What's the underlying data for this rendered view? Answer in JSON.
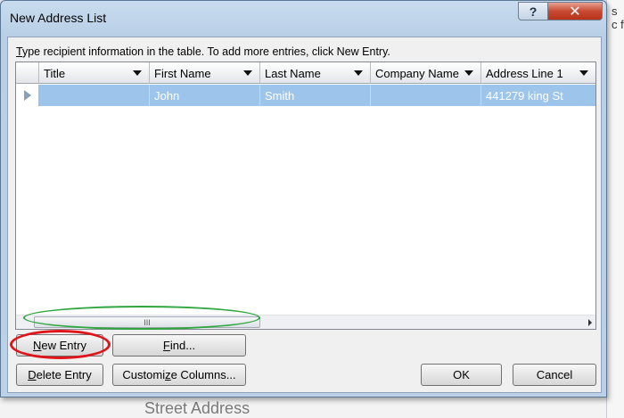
{
  "background": {
    "right_text_1": "s",
    "right_text_2": "c f",
    "bottom_text": "Street Address"
  },
  "dialog": {
    "title": "New Address List",
    "help_label": "?",
    "close_label": "✕",
    "instructions_accel": "T",
    "instructions_rest": "ype recipient information in the table.  To add more entries, click New Entry."
  },
  "grid": {
    "columns": [
      {
        "label": "Title"
      },
      {
        "label": "First Name"
      },
      {
        "label": "Last Name"
      },
      {
        "label": "Company Name"
      },
      {
        "label": "Address Line 1"
      }
    ],
    "row": [
      "",
      "John",
      "Smith",
      "",
      "441279 king St"
    ],
    "scroll_grip": "III"
  },
  "buttons": {
    "new_entry_accel": "N",
    "new_entry_rest": "ew Entry",
    "find_accel": "F",
    "find_rest": "ind...",
    "delete_entry_accel": "D",
    "delete_entry_rest": "elete Entry",
    "customize_pre": "Customi",
    "customize_accel": "z",
    "customize_post": "e Columns...",
    "ok": "OK",
    "cancel": "Cancel"
  },
  "colors": {
    "selection": "#9dc5ec",
    "annotation_green": "#2fa640",
    "annotation_red": "#e0151b"
  }
}
